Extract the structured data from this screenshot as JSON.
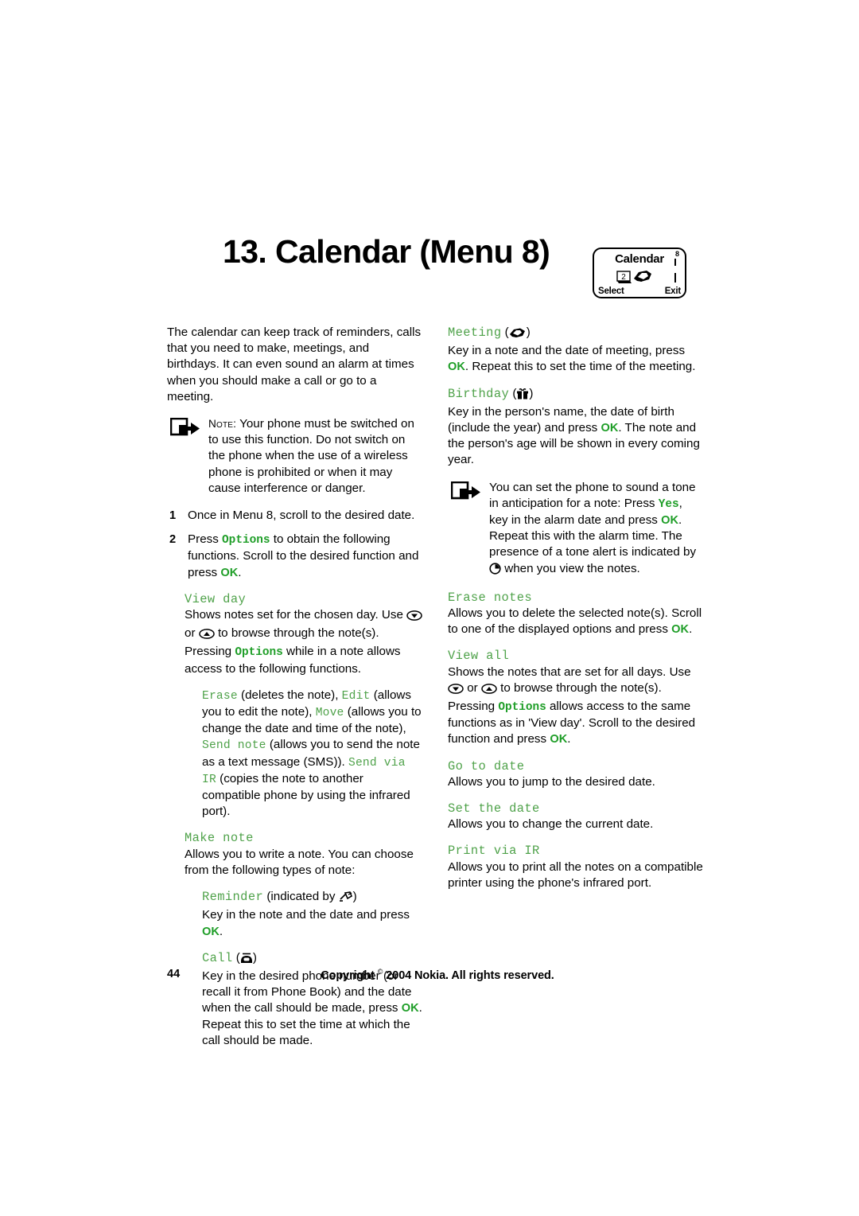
{
  "page": {
    "chapter_title": "13. Calendar (Menu 8)",
    "page_number": "44",
    "copyright": "Copyright © 2004 Nokia. All rights reserved.",
    "copyright_prefix": "Copyright",
    "copyright_suffix": "2004 Nokia. All rights reserved."
  },
  "phone_screen": {
    "title": "Calendar",
    "menu_number": "8",
    "softkey_left": "Select",
    "softkey_right": "Exit",
    "icon_name": "calendar-handshake-icon"
  },
  "left_column": {
    "intro": "The calendar can keep track of reminders, calls that you need to make, meetings, and birthdays. It can even sound an alarm at times when you should make a call or go to a meeting.",
    "note": {
      "label": "Note:",
      "text": "Your phone must be switched on to use this function. Do not switch on the phone when the use of a wireless phone is prohibited or when it may cause interference or danger."
    },
    "steps": [
      {
        "number": "1",
        "text": "Once in Menu 8, scroll to the desired date."
      },
      {
        "number": "2",
        "text_1": "Press ",
        "term_options": "Options",
        "text_2": " to obtain the following functions. Scroll to the desired function and press ",
        "term_ok": "OK",
        "text_3": "."
      }
    ],
    "view_day": {
      "heading": "View day",
      "text_1": "Shows notes set for the chosen day. Use ",
      "icon_down": "scroll-down-icon",
      "text_2": " or ",
      "icon_up": "scroll-up-icon",
      "text_3": " to browse through the note(s). Pressing ",
      "term_options": "Options",
      "text_4": " while in a note allows access to the following functions."
    },
    "view_day_functions": {
      "term_erase": "Erase",
      "t1": " (deletes the note), ",
      "term_edit": "Edit",
      "t2": " (allows you to edit the note), ",
      "term_move": "Move",
      "t3": " (allows you to change the date and time of the note), ",
      "term_send_note": "Send note",
      "t4": " (allows you to send the note as a text message (SMS)). ",
      "term_send_via_ir": "Send via IR",
      "t5": " (copies the note to another compatible phone by using the infrared port)."
    },
    "make_note": {
      "heading": "Make note",
      "text": "Allows you to write a note. You can choose from the following types of note:"
    },
    "reminder": {
      "heading": "Reminder",
      "head_suffix_1": " (indicated by ",
      "icon": "reminder-pen-icon",
      "head_suffix_2": ")",
      "text_1": "Key in the note and the date and press ",
      "term_ok": "OK",
      "text_2": "."
    },
    "call": {
      "heading": "Call",
      "head_suffix_1": " (",
      "icon": "telephone-icon",
      "head_suffix_2": ")",
      "text_1": "Key in the desired phone number (or recall it from Phone Book) and the date when the call should be made, press ",
      "term_ok": "OK",
      "text_2": ". Repeat this to set the time at which the call should be made."
    }
  },
  "right_column": {
    "meeting": {
      "heading": "Meeting",
      "head_suffix_1": " (",
      "icon": "handshake-icon",
      "head_suffix_2": ")",
      "text_1": "Key in a note and the date of meeting, press ",
      "term_ok": "OK",
      "text_2": ". Repeat this to set the time of the meeting."
    },
    "birthday": {
      "heading": "Birthday",
      "head_suffix_1": " (",
      "icon": "gift-box-icon",
      "head_suffix_2": ")",
      "text_1": "Key in the person's name, the date of birth (include the year) and press ",
      "term_ok": "OK",
      "text_2": ". The note and the person's age will be shown in every coming year."
    },
    "note": {
      "text_1": "You can set the phone to sound a tone in anticipation for a note: Press ",
      "term_yes": "Yes",
      "text_2": ", key in the alarm date and press ",
      "term_ok": "OK",
      "text_3": ". Repeat this with the alarm time. The presence of a tone alert is indicated by ",
      "icon_clock": "clock-icon",
      "text_4": " when you view the notes."
    },
    "erase_notes": {
      "heading": "Erase notes",
      "text_1": "Allows you to delete the selected note(s). Scroll to one of the displayed options and press ",
      "term_ok": "OK",
      "text_2": "."
    },
    "view_all": {
      "heading": "View all",
      "text_1": "Shows the notes that are set for all days. Use ",
      "icon_down": "scroll-down-icon",
      "text_2": " or ",
      "icon_up": "scroll-up-icon",
      "text_3": " to browse through the note(s). Pressing ",
      "term_options": "Options",
      "text_4": " allows access to the same functions as in 'View day'. Scroll to the desired function and press ",
      "term_ok": "OK",
      "text_5": "."
    },
    "go_to_date": {
      "heading": "Go to date",
      "text": "Allows you to jump to the desired date."
    },
    "set_the_date": {
      "heading": "Set the date",
      "text": "Allows you to change the current date."
    },
    "print_via_ir": {
      "heading": "Print via IR",
      "text": "Allows you to print all the notes on a compatible printer using the phone's infrared port."
    }
  },
  "colors": {
    "term_green": "#4fa24a",
    "bold_green": "#1f9e28",
    "text_black": "#000000",
    "page_background": "#ffffff"
  }
}
